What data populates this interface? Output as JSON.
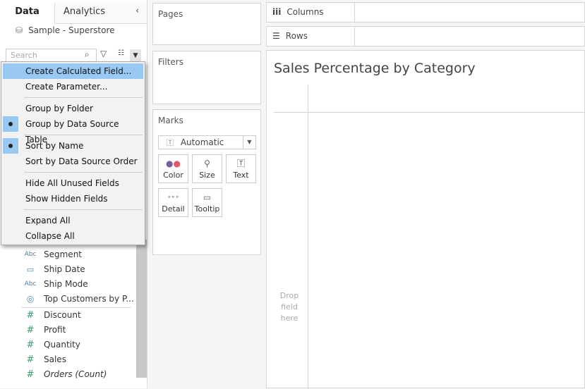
{
  "left_panel": {
    "tabs": [
      "Data",
      "Analytics"
    ],
    "datasource": "Sample - Superstore",
    "search_placeholder": "Search",
    "fields": [
      {
        "icon": "Abc",
        "name": "Segment"
      },
      {
        "icon": "calendar-icon",
        "name": "Ship Date"
      },
      {
        "icon": "Abc",
        "name": "Ship Mode"
      },
      {
        "icon": "set-icon",
        "name": "Top Customers by P..."
      },
      {
        "icon": "#",
        "name": "Discount"
      },
      {
        "icon": "#",
        "name": "Profit"
      },
      {
        "icon": "#",
        "name": "Quantity"
      },
      {
        "icon": "#",
        "name": "Sales"
      },
      {
        "icon": "#",
        "name": "Orders (Count)"
      }
    ]
  },
  "menu": {
    "items": [
      "Create Calculated Field...",
      "Create Parameter...",
      "Group by Folder",
      "Group by Data Source Table",
      "Sort by Name",
      "Sort by Data Source Order",
      "Hide All Unused Fields",
      "Show Hidden Fields",
      "Expand All",
      "Collapse All"
    ],
    "checked": [
      "Group by Data Source Table",
      "Sort by Name"
    ]
  },
  "cards": {
    "pages": "Pages",
    "filters": "Filters",
    "marks": "Marks",
    "mark_type": "Automatic",
    "buttons": [
      "Color",
      "Size",
      "Text",
      "Detail",
      "Tooltip"
    ]
  },
  "shelves": {
    "columns": "Columns",
    "rows": "Rows"
  },
  "view": {
    "title": "Sales Percentage by Category",
    "drop_hint": "Drop field here"
  },
  "colors": {
    "highlight": "#99c9f2",
    "measure": "#3a9a6e",
    "dimension": "#4a7ea0"
  }
}
